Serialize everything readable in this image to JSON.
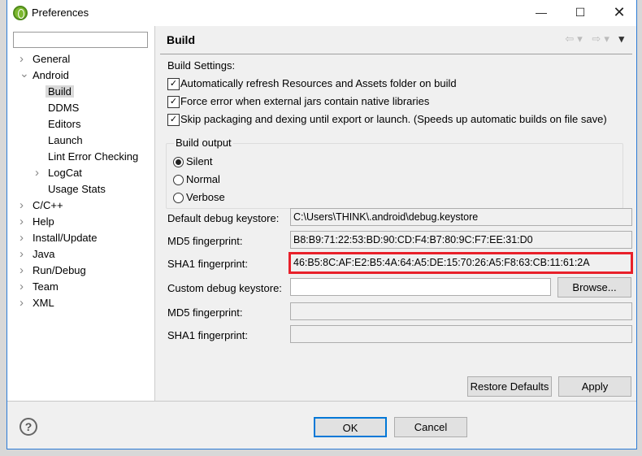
{
  "window": {
    "title": "Preferences",
    "icon": "eclipse-adt-icon",
    "buttons": [
      "minimize-icon",
      "maximize-icon",
      "close-icon"
    ]
  },
  "sidebar": {
    "filter_value": "",
    "items": [
      {
        "label": "General",
        "level": 0,
        "expander": "collapsed"
      },
      {
        "label": "Android",
        "level": 0,
        "expander": "expanded"
      },
      {
        "label": "Build",
        "level": 1,
        "selected": true
      },
      {
        "label": "DDMS",
        "level": 1
      },
      {
        "label": "Editors",
        "level": 1
      },
      {
        "label": "Launch",
        "level": 1
      },
      {
        "label": "Lint Error Checking",
        "level": 1
      },
      {
        "label": "LogCat",
        "level": 1,
        "expander": "collapsed"
      },
      {
        "label": "Usage Stats",
        "level": 1
      },
      {
        "label": "C/C++",
        "level": 0,
        "expander": "collapsed"
      },
      {
        "label": "Help",
        "level": 0,
        "expander": "collapsed"
      },
      {
        "label": "Install/Update",
        "level": 0,
        "expander": "collapsed"
      },
      {
        "label": "Java",
        "level": 0,
        "expander": "collapsed"
      },
      {
        "label": "Run/Debug",
        "level": 0,
        "expander": "collapsed"
      },
      {
        "label": "Team",
        "level": 0,
        "expander": "collapsed"
      },
      {
        "label": "XML",
        "level": 0,
        "expander": "collapsed"
      }
    ]
  },
  "page": {
    "title": "Build",
    "build_settings_label": "Build Settings:",
    "checkboxes": [
      {
        "label": "Automatically refresh Resources and Assets folder on build",
        "checked": true
      },
      {
        "label": "Force error when external jars contain native libraries",
        "checked": true
      },
      {
        "label": "Skip packaging and dexing until export or launch. (Speeds up automatic builds on file save)",
        "checked": true
      }
    ],
    "build_output": {
      "label": "Build output",
      "options": [
        {
          "label": "Silent",
          "selected": true
        },
        {
          "label": "Normal",
          "selected": false
        },
        {
          "label": "Verbose",
          "selected": false
        }
      ]
    },
    "fields": [
      {
        "label": "Default debug keystore:",
        "value": "C:\\Users\\THINK\\.android\\debug.keystore"
      },
      {
        "label": "MD5 fingerprint:",
        "value": "B8:B9:71:22:53:BD:90:CD:F4:B7:80:9C:F7:EE:31:D0"
      },
      {
        "label": "SHA1 fingerprint:",
        "value": "46:B5:8C:AF:E2:B5:4A:64:A5:DE:15:70:26:A5:F8:63:CB:11:61:2A"
      },
      {
        "label": "Custom debug keystore:",
        "value": ""
      },
      {
        "label": "MD5 fingerprint:",
        "value": ""
      },
      {
        "label": "SHA1 fingerprint:",
        "value": ""
      }
    ],
    "browse_label": "Browse...",
    "restore_defaults_label": "Restore Defaults",
    "apply_label": "Apply",
    "highlight_color": "#e8202a"
  },
  "footer": {
    "ok_label": "OK",
    "cancel_label": "Cancel",
    "help_icon": "help-icon"
  }
}
